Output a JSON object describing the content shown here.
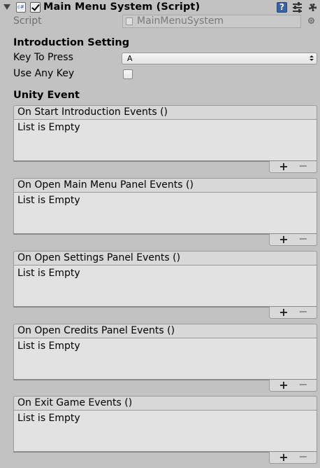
{
  "component": {
    "title": "Main Menu System (Script)",
    "enabled": true
  },
  "script_field": {
    "label": "Script",
    "value": "MainMenuSystem"
  },
  "introduction": {
    "header": "Introduction Setting",
    "key_to_press_label": "Key To Press",
    "key_to_press_value": "A",
    "use_any_key_label": "Use Any Key",
    "use_any_key_checked": false
  },
  "unity_event": {
    "header": "Unity Event",
    "add_symbol": "+",
    "remove_symbol": "−",
    "events": [
      {
        "name": "On Start Introduction Events ()",
        "content": "List is Empty"
      },
      {
        "name": "On Open Main Menu Panel Events ()",
        "content": "List is Empty"
      },
      {
        "name": "On Open Settings Panel Events ()",
        "content": "List is Empty"
      },
      {
        "name": "On Open Credits Panel Events ()",
        "content": "List is Empty"
      },
      {
        "name": "On Exit Game Events ()",
        "content": "List is Empty"
      }
    ]
  },
  "colors": {
    "background": "#c2c2c2",
    "help_icon": "#3b63a3"
  }
}
